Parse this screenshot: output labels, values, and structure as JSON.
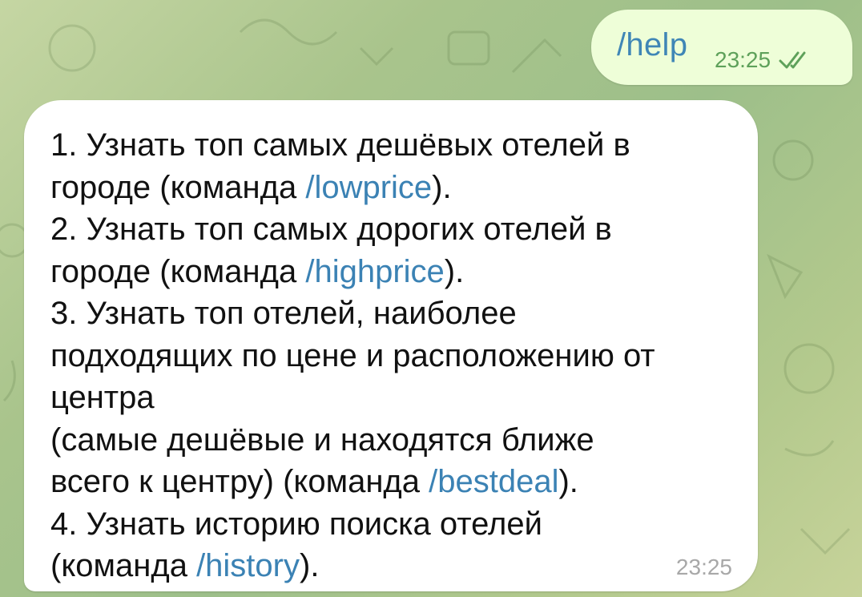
{
  "outgoing": {
    "text": "/help",
    "time": "23:25",
    "status_icon": "double-check-icon",
    "colors": {
      "bubble": "#eefed8",
      "time": "#5ea15a",
      "link": "#3f86b6"
    }
  },
  "incoming": {
    "time": "23:25",
    "lines": [
      {
        "pre": "1. Узнать топ самых дешёвых отелей в"
      },
      {
        "pre": "городе (команда ",
        "link": "/lowprice",
        "post": ")."
      },
      {
        "pre": "2. Узнать топ самых дорогих отелей в"
      },
      {
        "pre": "городе (команда ",
        "link": "/highprice",
        "post": ")."
      },
      {
        "pre": "3. Узнать топ отелей, наиболее"
      },
      {
        "pre": "подходящих по цене и расположению от"
      },
      {
        "pre": "центра"
      },
      {
        "pre": "(самые дешёвые и находятся ближе"
      },
      {
        "pre": "всего к центру) (команда ",
        "link": "/bestdeal",
        "post": ")."
      },
      {
        "pre": "4. Узнать историю поиска отелей"
      },
      {
        "pre": "(команда ",
        "link": "/history",
        "post": ")."
      }
    ],
    "colors": {
      "bubble": "#ffffff",
      "text": "#111111",
      "link": "#3b82b4",
      "time": "#a8a8a8"
    }
  },
  "background": {
    "colors": [
      "#c5d6a3",
      "#9dbf8a",
      "#c7d39a"
    ]
  }
}
